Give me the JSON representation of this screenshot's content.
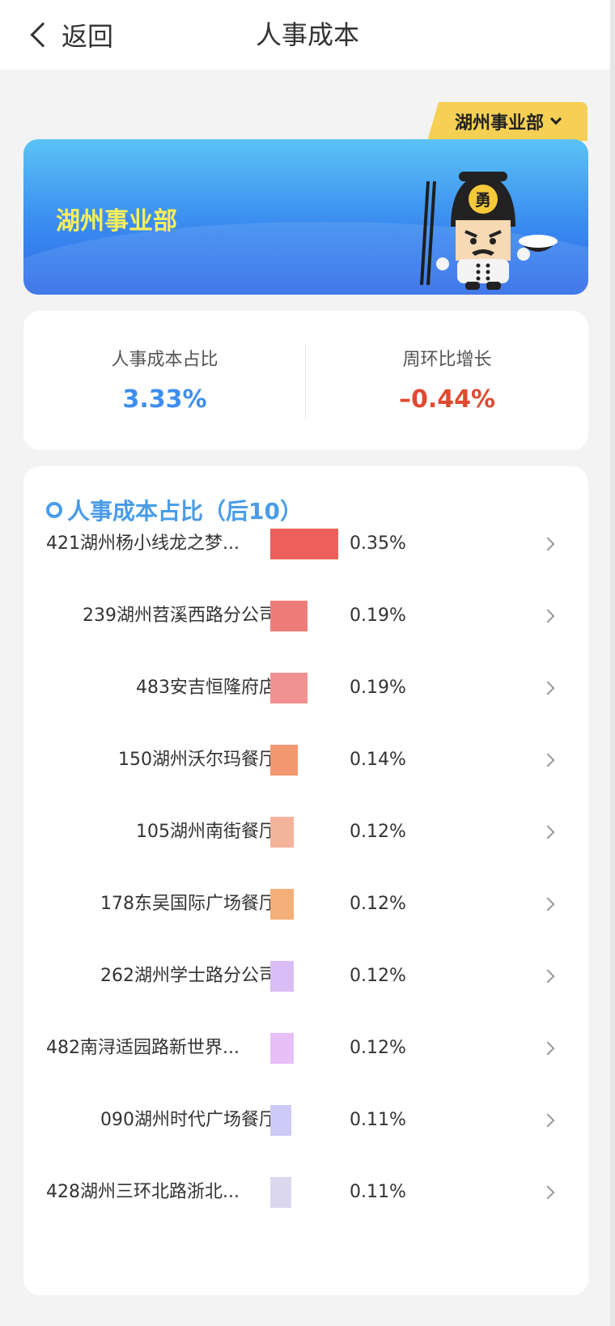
{
  "nav": {
    "back_label": "返回",
    "title": "人事成本"
  },
  "department_selector": {
    "selected": "湖州事业部"
  },
  "banner": {
    "title": "湖州事业部",
    "mascot_icon": "mascot-chef-icon",
    "mascot_badge": "勇"
  },
  "stats": {
    "ratio_label": "人事成本占比",
    "ratio_value": "3.33%",
    "ratio_color": "#3d8ef0",
    "wow_label": "周环比增长",
    "wow_value": "–0.44%",
    "wow_color": "#e04a2f"
  },
  "ranking": {
    "title": "人事成本占比（后10）",
    "items": [
      {
        "name": "421湖州杨小线龙之梦...",
        "value": "0.35%",
        "ratio": 0.35,
        "color": "#ee605c"
      },
      {
        "name": "239湖州苕溪西路分公司",
        "value": "0.19%",
        "ratio": 0.19,
        "color": "#ee7d7a"
      },
      {
        "name": "483安吉恒隆府店",
        "value": "0.19%",
        "ratio": 0.19,
        "color": "#f09090"
      },
      {
        "name": "150湖州沃尔玛餐厅",
        "value": "0.14%",
        "ratio": 0.14,
        "color": "#f29770"
      },
      {
        "name": "105湖州南街餐厅",
        "value": "0.12%",
        "ratio": 0.12,
        "color": "#f4b39b"
      },
      {
        "name": "178东吴国际广场餐厅",
        "value": "0.12%",
        "ratio": 0.12,
        "color": "#f5b079"
      },
      {
        "name": "262湖州学士路分公司",
        "value": "0.12%",
        "ratio": 0.12,
        "color": "#d8bdf6"
      },
      {
        "name": "482南浔适园路新世界...",
        "value": "0.12%",
        "ratio": 0.12,
        "color": "#e8bff7"
      },
      {
        "name": "090湖州时代广场餐厅",
        "value": "0.11%",
        "ratio": 0.11,
        "color": "#cdcaf7"
      },
      {
        "name": "428湖州三环北路浙北...",
        "value": "0.11%",
        "ratio": 0.11,
        "color": "#dad7ee"
      }
    ]
  }
}
